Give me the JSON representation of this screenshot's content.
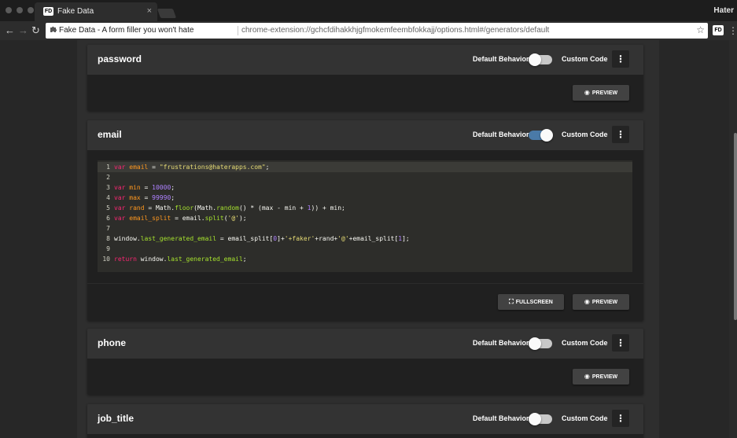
{
  "tab": {
    "title": "Fake Data",
    "favicon_text": "FD",
    "close": "×"
  },
  "profile": {
    "name": "Hater"
  },
  "address": {
    "page_title": "Fake Data - A form filler you won't hate",
    "url": "chrome-extension://gchcfdihakkhjgfmokemfeembfokkajj/options.html#/generators/default"
  },
  "extension": {
    "badge": "FD"
  },
  "icons": {
    "back": "←",
    "forward": "→",
    "reload": "↻",
    "extension": "puzzle-icon",
    "star": "☆",
    "menu": "⋮",
    "kebab": "⋮",
    "eye": "◉",
    "fullscreen": "⛶"
  },
  "labels": {
    "default_behavior": "Default Behavior",
    "custom_code": "Custom Code",
    "preview": "PREVIEW",
    "fullscreen": "FULLSCREEN"
  },
  "generators": [
    {
      "name": "password",
      "custom_code": false
    },
    {
      "name": "email",
      "custom_code": true
    },
    {
      "name": "phone",
      "custom_code": false
    },
    {
      "name": "job_title",
      "custom_code": false
    }
  ],
  "code_lines": [
    {
      "n": "1",
      "tokens": [
        {
          "t": "var ",
          "c": "kw"
        },
        {
          "t": "email",
          "c": "var"
        },
        {
          "t": " = ",
          "c": "pl"
        },
        {
          "t": "\"frustrations@haterapps.com\"",
          "c": "str"
        },
        {
          "t": ";",
          "c": "pl"
        }
      ]
    },
    {
      "n": "2",
      "tokens": []
    },
    {
      "n": "3",
      "tokens": [
        {
          "t": "var ",
          "c": "kw"
        },
        {
          "t": "min",
          "c": "var"
        },
        {
          "t": " = ",
          "c": "pl"
        },
        {
          "t": "10000",
          "c": "num"
        },
        {
          "t": ";",
          "c": "pl"
        }
      ]
    },
    {
      "n": "4",
      "tokens": [
        {
          "t": "var ",
          "c": "kw"
        },
        {
          "t": "max",
          "c": "var"
        },
        {
          "t": " = ",
          "c": "pl"
        },
        {
          "t": "99990",
          "c": "num"
        },
        {
          "t": ";",
          "c": "pl"
        }
      ]
    },
    {
      "n": "5",
      "tokens": [
        {
          "t": "var ",
          "c": "kw"
        },
        {
          "t": "rand",
          "c": "var"
        },
        {
          "t": " = Math.",
          "c": "pl"
        },
        {
          "t": "floor",
          "c": "fn"
        },
        {
          "t": "(Math.",
          "c": "pl"
        },
        {
          "t": "random",
          "c": "fn"
        },
        {
          "t": "() * (max - min + ",
          "c": "pl"
        },
        {
          "t": "1",
          "c": "num"
        },
        {
          "t": ")) + min;",
          "c": "pl"
        }
      ]
    },
    {
      "n": "6",
      "tokens": [
        {
          "t": "var ",
          "c": "kw"
        },
        {
          "t": "email_split",
          "c": "var"
        },
        {
          "t": " = email.",
          "c": "pl"
        },
        {
          "t": "split",
          "c": "fn"
        },
        {
          "t": "(",
          "c": "pl"
        },
        {
          "t": "'@'",
          "c": "str"
        },
        {
          "t": ");",
          "c": "pl"
        }
      ]
    },
    {
      "n": "7",
      "tokens": []
    },
    {
      "n": "8",
      "tokens": [
        {
          "t": "window.",
          "c": "pl"
        },
        {
          "t": "last_generated_email",
          "c": "fn"
        },
        {
          "t": " = email_split[",
          "c": "pl"
        },
        {
          "t": "0",
          "c": "num"
        },
        {
          "t": "]+",
          "c": "pl"
        },
        {
          "t": "'+faker'",
          "c": "str"
        },
        {
          "t": "+rand+",
          "c": "pl"
        },
        {
          "t": "'@'",
          "c": "str"
        },
        {
          "t": "+email_split[",
          "c": "pl"
        },
        {
          "t": "1",
          "c": "num"
        },
        {
          "t": "];",
          "c": "pl"
        }
      ]
    },
    {
      "n": "9",
      "tokens": []
    },
    {
      "n": "10",
      "tokens": [
        {
          "t": "return ",
          "c": "kw"
        },
        {
          "t": "window.",
          "c": "pl"
        },
        {
          "t": "last_generated_email",
          "c": "fn"
        },
        {
          "t": ";",
          "c": "pl"
        }
      ]
    }
  ],
  "colors": {
    "switch_on": "#4a7aa8",
    "keyword": "#f92672",
    "variable": "#fd971f",
    "string": "#e6db74",
    "number": "#ae81ff",
    "function": "#a6e22e"
  }
}
